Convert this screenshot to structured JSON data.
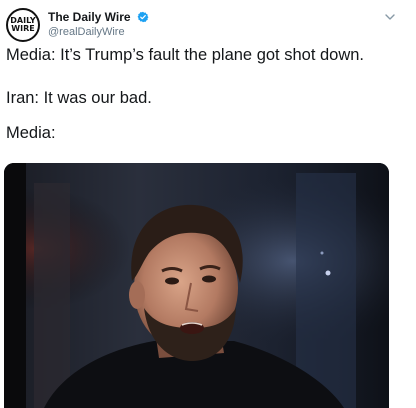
{
  "header": {
    "avatar_line1": "DAILY",
    "avatar_line2": "WIRE",
    "author_name": "The Daily Wire",
    "author_handle": "@realDailyWire",
    "verified_icon": "verified-badge-icon",
    "menu_icon": "chevron-down-icon"
  },
  "tweet": {
    "lines": [
      "Media: It’s Trump’s fault the plane got shot down.",
      "Iran: It was our bad.",
      "Media:"
    ]
  },
  "media": {
    "kind": "image",
    "description_icon": "embedded-photo"
  },
  "colors": {
    "text": "#14171a",
    "secondary": "#657786",
    "verified": "#1da1f2"
  }
}
